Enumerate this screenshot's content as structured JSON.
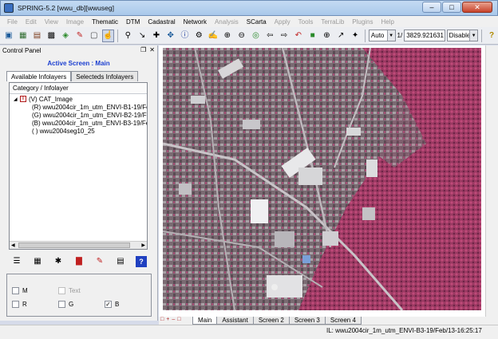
{
  "window": {
    "title": "SPRING-5.2 [wwu_db][wwuseg]"
  },
  "menu": [
    {
      "label": "File",
      "enabled": false
    },
    {
      "label": "Edit",
      "enabled": false
    },
    {
      "label": "View",
      "enabled": false
    },
    {
      "label": "Image",
      "enabled": false
    },
    {
      "label": "Thematic",
      "enabled": true
    },
    {
      "label": "DTM",
      "enabled": true
    },
    {
      "label": "Cadastral",
      "enabled": true
    },
    {
      "label": "Network",
      "enabled": true
    },
    {
      "label": "Analysis",
      "enabled": false
    },
    {
      "label": "SCarta",
      "enabled": true
    },
    {
      "label": "Apply",
      "enabled": false
    },
    {
      "label": "Tools",
      "enabled": false
    },
    {
      "label": "TerraLib",
      "enabled": false
    },
    {
      "label": "Plugins",
      "enabled": false
    },
    {
      "label": "Help",
      "enabled": false
    }
  ],
  "toolbar": {
    "zoom_mode": "Auto",
    "scale_prefix": "1/",
    "scale_value": "3829.921631",
    "mode_select": "Disable"
  },
  "control_panel": {
    "title": "Control Panel",
    "active_screen": "Active Screen : Main",
    "tabs": [
      "Available Infolayers",
      "Selecteds Infolayers"
    ],
    "tree_header": "Category / Infolayer",
    "category": "(V) CAT_Image",
    "layers": [
      "(R) wwu2004cir_1m_utm_ENVI-B1-19/Fe",
      "(G) wwu2004cir_1m_utm_ENVI-B2-19/Fe",
      "(B) wwu2004cir_1m_utm_ENVI-B3-19/Fe",
      "( ) wwu2004seg10_25"
    ],
    "checkboxes": [
      {
        "label": "M",
        "checked": false,
        "enabled": true
      },
      {
        "label": "Text",
        "checked": false,
        "enabled": false
      },
      {
        "label": "R",
        "checked": false,
        "enabled": true
      },
      {
        "label": "G",
        "checked": false,
        "enabled": true
      },
      {
        "label": "B",
        "checked": true,
        "enabled": true
      }
    ]
  },
  "screen_tabs": [
    "Main",
    "Assistant",
    "Screen 2",
    "Screen 3",
    "Screen 4"
  ],
  "status": "IL: wwu2004cir_1m_utm_ENVI-B3-19/Feb/13-16:25:17",
  "colors": {
    "vegetation": "#a0345c",
    "urban": "#c8c8c8",
    "accent": "#1c3fd0"
  }
}
